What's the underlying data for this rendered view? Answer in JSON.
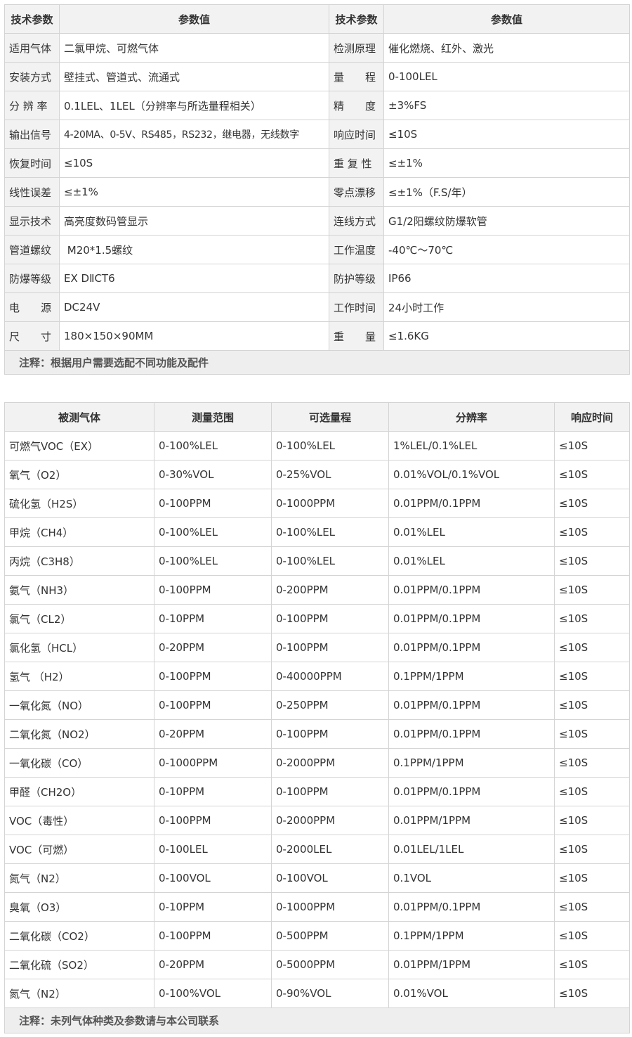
{
  "spec": {
    "headers": [
      "技术参数",
      "参数值",
      "技术参数",
      "参数值"
    ],
    "rows": [
      [
        "适用气体",
        "二氯甲烷、可燃气体",
        "检测原理",
        "催化燃烧、红外、激光"
      ],
      [
        "安装方式",
        "壁挂式、管道式、流通式",
        "量　　程",
        "0-100LEL"
      ],
      [
        "分 辨 率",
        "0.1LEL、1LEL（分辨率与所选量程相关）",
        "精　　度",
        "±3%FS"
      ],
      [
        "输出信号",
        "4-20MA、0-5V、RS485，RS232，继电器，无线数字",
        "响应时间",
        "≤10S"
      ],
      [
        "恢复时间",
        "≤10S",
        "重 复 性",
        "≤±1%"
      ],
      [
        "线性误差",
        "≤±1%",
        "零点漂移",
        "≤±1%（F.S/年）"
      ],
      [
        "显示技术",
        "高亮度数码管显示",
        "连线方式",
        "G1/2阳螺纹防爆软管"
      ],
      [
        "管道螺纹",
        " M20*1.5螺纹",
        "工作温度",
        "-40℃～70℃"
      ],
      [
        "防爆等级",
        "EX DⅡCT6",
        "防护等级",
        "IP66"
      ],
      [
        "电　　源",
        "DC24V",
        "工作时间",
        "24小时工作"
      ],
      [
        "尺　　寸",
        "180×150×90MM",
        "重　　量",
        "≤1.6KG"
      ]
    ],
    "note": "注释：根据用户需要选配不同功能及配件"
  },
  "gases": {
    "headers": [
      "被测气体",
      "测量范围",
      "可选量程",
      "分辨率",
      "响应时间"
    ],
    "rows": [
      [
        "可燃气VOC（EX）",
        "0-100%LEL",
        "0-100%LEL",
        "1%LEL/0.1%LEL",
        "≤10S"
      ],
      [
        "氧气（O2）",
        "0-30%VOL",
        "0-25%VOL",
        "0.01%VOL/0.1%VOL",
        "≤10S"
      ],
      [
        "硫化氢（H2S）",
        "0-100PPM",
        "0-1000PPM",
        "0.01PPM/0.1PPM",
        "≤10S"
      ],
      [
        "甲烷（CH4）",
        "0-100%LEL",
        "0-100%LEL",
        "0.01%LEL",
        "≤10S"
      ],
      [
        "丙烷（C3H8）",
        "0-100%LEL",
        "0-100%LEL",
        "0.01%LEL",
        "≤10S"
      ],
      [
        "氨气（NH3）",
        "0-100PPM",
        "0-200PPM",
        "0.01PPM/0.1PPM",
        "≤10S"
      ],
      [
        "氯气（CL2）",
        "0-10PPM",
        "0-100PPM",
        "0.01PPM/0.1PPM",
        "≤10S"
      ],
      [
        "氯化氢（HCL）",
        "0-20PPM",
        "0-100PPM",
        "0.01PPM/0.1PPM",
        "≤10S"
      ],
      [
        "氢气 （H2）",
        "0-100PPM",
        "0-40000PPM",
        "0.1PPM/1PPM",
        "≤10S"
      ],
      [
        "一氧化氮（NO）",
        "0-100PPM",
        "0-250PPM",
        "0.01PPM/0.1PPM",
        "≤10S"
      ],
      [
        "二氧化氮（NO2）",
        "0-20PPM",
        "0-100PPM",
        "0.01PPM/0.1PPM",
        "≤10S"
      ],
      [
        "一氧化碳（CO）",
        "0-1000PPM",
        "0-2000PPM",
        "0.1PPM/1PPM",
        "≤10S"
      ],
      [
        "甲醛（CH2O）",
        "0-10PPM",
        "0-100PPM",
        "0.01PPM/0.1PPM",
        "≤10S"
      ],
      [
        "VOC（毒性）",
        "0-100PPM",
        "0-2000PPM",
        "0.01PPM/1PPM",
        "≤10S"
      ],
      [
        "VOC（可燃）",
        "0-100LEL",
        "0-2000LEL",
        "0.01LEL/1LEL",
        "≤10S"
      ],
      [
        "氮气（N2）",
        "0-100VOL",
        "0-100VOL",
        "0.1VOL",
        "≤10S"
      ],
      [
        "臭氧（O3）",
        "0-10PPM",
        "0-1000PPM",
        "0.01PPM/0.1PPM",
        "≤10S"
      ],
      [
        "二氧化碳（CO2）",
        "0-100PPM",
        "0-500PPM",
        "0.1PPM/1PPM",
        "≤10S"
      ],
      [
        "二氧化硫（SO2）",
        "0-20PPM",
        "0-5000PPM",
        "0.01PPM/1PPM",
        "≤10S"
      ],
      [
        "氮气（N2）",
        "0-100%VOL",
        "0-90%VOL",
        "0.01%VOL",
        "≤10S"
      ]
    ],
    "note": "注释：未列气体种类及参数请与本公司联系"
  }
}
